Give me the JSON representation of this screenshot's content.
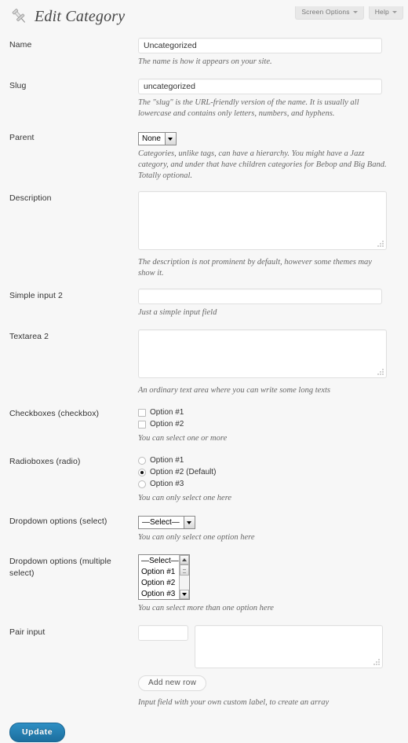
{
  "screen_meta": {
    "screen_options_label": "Screen Options",
    "help_label": "Help"
  },
  "header": {
    "title": "Edit Category",
    "icon": "pushpin-icon"
  },
  "fields": {
    "name": {
      "label": "Name",
      "value": "Uncategorized",
      "description": "The name is how it appears on your site."
    },
    "slug": {
      "label": "Slug",
      "value": "uncategorized",
      "description": "The \"slug\" is the URL-friendly version of the name. It is usually all lowercase and contains only letters, numbers, and hyphens."
    },
    "parent": {
      "label": "Parent",
      "selected": "None",
      "description": "Categories, unlike tags, can have a hierarchy. You might have a Jazz category, and under that have children categories for Bebop and Big Band. Totally optional."
    },
    "category_description": {
      "label": "Description",
      "value": "",
      "description": "The description is not prominent by default, however some themes may show it."
    },
    "simple_input_2": {
      "label": "Simple input 2",
      "value": "",
      "description": "Just a simple input field"
    },
    "textarea_2": {
      "label": "Textarea 2",
      "value": "",
      "description": "An ordinary text area where you can write some long texts"
    },
    "checkboxes": {
      "label": "Checkboxes (checkbox)",
      "description": "You can select one or more",
      "options": [
        {
          "label": "Option #1",
          "checked": false
        },
        {
          "label": "Option #2",
          "checked": false
        }
      ]
    },
    "radioboxes": {
      "label": "Radioboxes (radio)",
      "description": "You can only select one here",
      "options": [
        {
          "label": "Option #1",
          "checked": false
        },
        {
          "label": "Option #2 (Default)",
          "checked": true
        },
        {
          "label": "Option #3",
          "checked": false
        }
      ]
    },
    "dropdown_select": {
      "label": "Dropdown options (select)",
      "selected": "—Select—",
      "description": "You can only select one option here"
    },
    "dropdown_multiple": {
      "label": "Dropdown options (multiple select)",
      "description": "You can select more than one option here",
      "options": [
        "—Select—",
        "Option #1",
        "Option #2",
        "Option #3"
      ]
    },
    "pair_input": {
      "label": "Pair input",
      "key_value": "",
      "value_value": "",
      "add_row_label": "Add new row",
      "description": "Input field with your own custom label, to create an array"
    }
  },
  "submit": {
    "update_label": "Update"
  },
  "colors": {
    "page_bg": "#f7f7f7",
    "primary_button": "#2480b3",
    "border": "#dfdfdf",
    "description_text": "#666666"
  }
}
